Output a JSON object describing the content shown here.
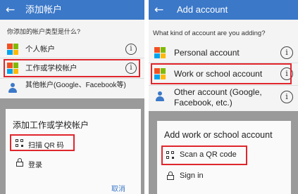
{
  "left": {
    "appbar": {
      "back_icon": "←",
      "title": "添加帐户"
    },
    "question": "你添加的帐户类型是什么?",
    "accounts": [
      {
        "label": "个人帐户",
        "icon": "microsoft-logo-icon"
      },
      {
        "label": "工作或学校帐户",
        "icon": "microsoft-logo-icon"
      },
      {
        "label": "其他帐户(Google、Facebook等)",
        "icon": "person-icon"
      }
    ],
    "info_glyph": "i",
    "sheet": {
      "title": "添加工作或学校帐户",
      "scan_qr": "扫描 QR 码",
      "sign_in": "登录",
      "cancel": "取消"
    }
  },
  "right": {
    "appbar": {
      "back_icon": "←",
      "title": "Add account"
    },
    "question": "What kind of account are you adding?",
    "accounts": [
      {
        "label": "Personal account",
        "icon": "microsoft-logo-icon"
      },
      {
        "label": "Work or school account",
        "icon": "microsoft-logo-icon"
      },
      {
        "label_line1": "Other account (Google,",
        "label_line2": "Facebook, etc.)",
        "icon": "person-icon"
      }
    ],
    "info_glyph": "i",
    "sheet": {
      "title": "Add work or school account",
      "scan_qr": "Scan a QR code",
      "sign_in": "Sign in"
    }
  },
  "colors": {
    "appbar": "#3b78c8",
    "highlight": "#e0262d",
    "ms_red": "#f25022",
    "ms_green": "#7fba00",
    "ms_blue": "#00a4ef",
    "ms_yellow": "#ffb900"
  }
}
